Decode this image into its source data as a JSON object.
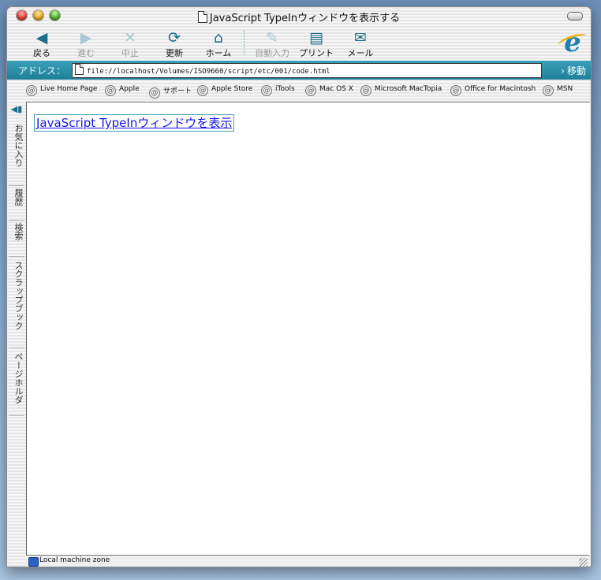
{
  "window": {
    "title": "JavaScript TypeInウィンドウを表示する"
  },
  "toolbar": {
    "buttons": [
      {
        "label": "戻る",
        "icon": "back-arrow-icon",
        "enabled": true
      },
      {
        "label": "進む",
        "icon": "forward-arrow-icon",
        "enabled": false
      },
      {
        "label": "中止",
        "icon": "stop-icon",
        "enabled": false
      },
      {
        "label": "更新",
        "icon": "refresh-icon",
        "enabled": true
      },
      {
        "label": "ホーム",
        "icon": "home-icon",
        "enabled": true
      },
      {
        "label": "自動入力",
        "icon": "autofill-icon",
        "enabled": false
      },
      {
        "label": "プリント",
        "icon": "printer-icon",
        "enabled": true
      },
      {
        "label": "メール",
        "icon": "mail-icon",
        "enabled": true
      }
    ]
  },
  "address": {
    "label": "アドレス：",
    "url": "file://localhost/Volumes/ISO9660/script/etc/001/code.html",
    "go_label": "移動"
  },
  "favorites": [
    "Live Home Page",
    "Apple",
    "サポート",
    "Apple Store",
    "iTools",
    "Mac OS X",
    "Microsoft MacTopia",
    "Office for Macintosh",
    "MSN"
  ],
  "sidebar": {
    "tabs": [
      "お気に入り",
      "履歴",
      "検索",
      "スクラップブック",
      "ページホルダ"
    ]
  },
  "content": {
    "link_text": "JavaScript TypeInウィンドウを表示"
  },
  "status": {
    "zone": "Local machine zone"
  },
  "colors": {
    "accent": "#1e7f99",
    "link": "#1515ee",
    "desktop": "#8fb0d6"
  }
}
